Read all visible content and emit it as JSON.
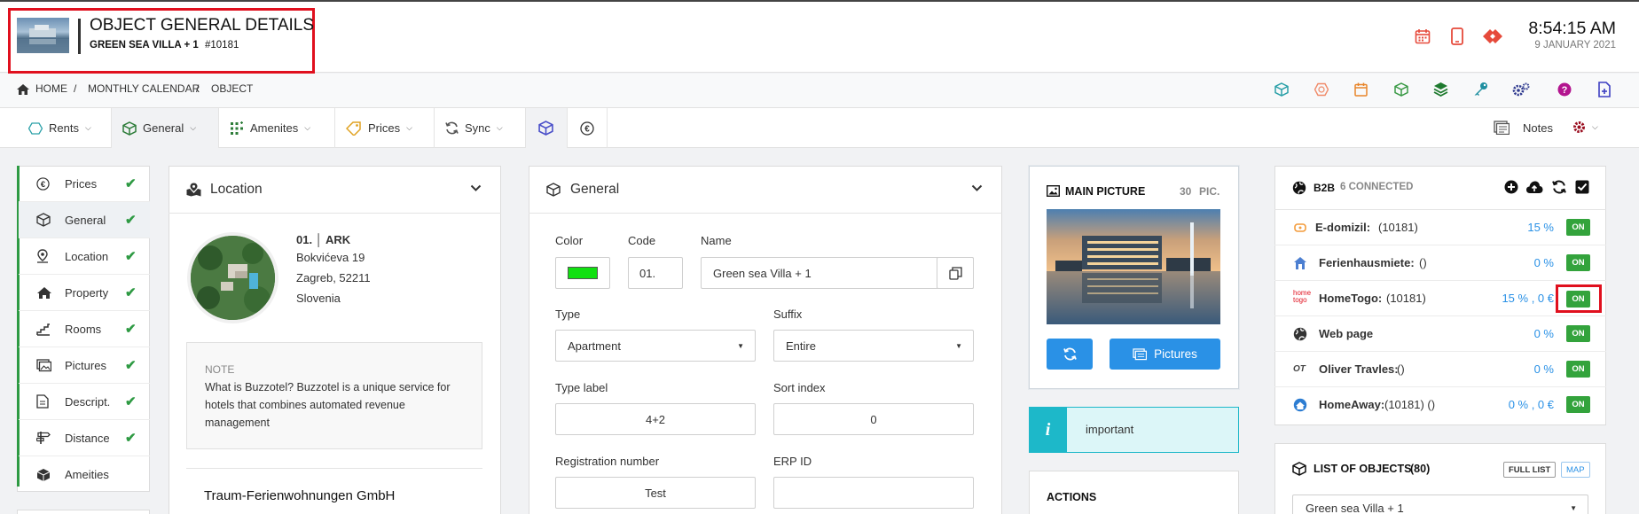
{
  "header": {
    "title": "OBJECT GENERAL DETAILS",
    "subtitle": "GREEN SEA VILLA + 1",
    "object_id": "#10181",
    "time": "8:54:15 AM",
    "date": "9 JANUARY 2021"
  },
  "breadcrumb": [
    "HOME",
    "MONTHLY CALENDAR",
    "OBJECT"
  ],
  "breadcrumb_sep": "/",
  "tabs": {
    "rents": "Rents",
    "general": "General",
    "amenities": "Amenites",
    "prices": "Prices",
    "sync": "Sync",
    "notes": "Notes"
  },
  "sidebar": {
    "items": [
      {
        "label": "Prices",
        "check": "✔"
      },
      {
        "label": "General",
        "check": "✔"
      },
      {
        "label": "Location",
        "check": "✔"
      },
      {
        "label": "Property",
        "check": "✔"
      },
      {
        "label": "Rooms",
        "check": "✔"
      },
      {
        "label": "Pictures",
        "check": "✔"
      },
      {
        "label": "Descript.",
        "check": "✔"
      },
      {
        "label": "Distance",
        "check": "✔"
      },
      {
        "label": "Ameities",
        "check": ""
      }
    ]
  },
  "location": {
    "title": "Location",
    "code_name": "01. │ ARK",
    "street": "Bokvićeva 19",
    "city": "Zagreb, 52211",
    "country": "Slovenia",
    "note_label": "NOTE",
    "note_text": "What is Buzzotel? Buzzotel is a unique service for hotels that combines automated revenue management",
    "company": "Traum-Ferienwohnungen GmbH"
  },
  "general": {
    "title": "General",
    "color_label": "Color",
    "color_value": "#11e011",
    "code_label": "Code",
    "code_value": "01.",
    "name_label": "Name",
    "name_value": "Green sea Villa + 1",
    "type_label": "Type",
    "type_value": "Apartment",
    "suffix_label": "Suffix",
    "suffix_value": "Entire",
    "typelabel_label": "Type label",
    "typelabel_value": "4+2",
    "sort_label": "Sort index",
    "sort_value": "0",
    "reg_label": "Registration number",
    "reg_value": "Test",
    "erp_label": "ERP ID",
    "erp_value": ""
  },
  "main_picture": {
    "title": "MAIN PICTURE",
    "count": "30",
    "count_unit": "PIC.",
    "pictures_button": "Pictures"
  },
  "important": {
    "label": "important"
  },
  "actions": {
    "title": "ACTIONS"
  },
  "b2b": {
    "title": "B2B",
    "connected": "6 CONNECTED",
    "rows": [
      {
        "name": "E-domizil:",
        "id": "(10181)",
        "value": "15 %",
        "status": "ON"
      },
      {
        "name": "Ferienhausmiete:",
        "id": "()",
        "value": "0 %",
        "status": "ON"
      },
      {
        "name": "HomeTogo:",
        "id": "(10181)",
        "value": "15 % , 0 €",
        "status": "ON"
      },
      {
        "name": "Web page",
        "id": "",
        "value": "0 %",
        "status": "ON"
      },
      {
        "name": "Oliver Travles:",
        "id": "()",
        "value": "0 %",
        "status": "ON"
      },
      {
        "name": "HomeAway:",
        "id": "(10181) ()",
        "value": "0 % , 0 €",
        "status": "ON"
      }
    ],
    "logos": {
      "hometogo_top": "home",
      "hometogo_bottom": "togo",
      "oliver": "OT"
    }
  },
  "objects_list": {
    "title": "LIST OF OBJECTS",
    "count": "(80)",
    "full_list": "FULL LIST",
    "map": "MAP",
    "selected": "Green sea Villa + 1"
  },
  "colors": {
    "accent_blue": "#2a91e6",
    "success_green": "#2e9a43",
    "highlight_red": "#e0101e",
    "info_teal": "#1db8c9"
  }
}
